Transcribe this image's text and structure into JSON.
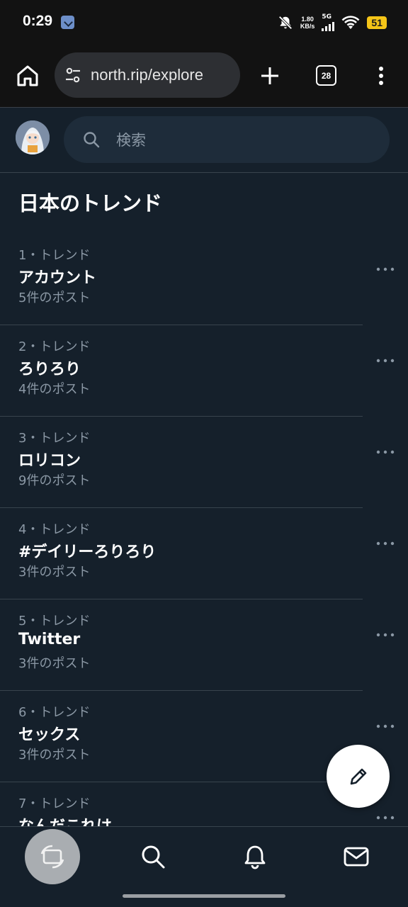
{
  "status_bar": {
    "time": "0:29",
    "net_speed_value": "1.80",
    "net_speed_unit": "KB/s",
    "network_type": "5G",
    "battery": "51",
    "battery_color": "#f5c518"
  },
  "browser": {
    "url": "north.rip/explore",
    "tab_count": "28"
  },
  "search": {
    "placeholder": "検索"
  },
  "section_title": "日本のトレンド",
  "trends": [
    {
      "meta": "1・トレンド",
      "name": "アカウント",
      "count": "5件のポスト"
    },
    {
      "meta": "2・トレンド",
      "name": "ろりろり",
      "count": "4件のポスト"
    },
    {
      "meta": "3・トレンド",
      "name": "ロリコン",
      "count": "9件のポスト"
    },
    {
      "meta": "4・トレンド",
      "name": "#デイリーろりろり",
      "count": "3件のポスト"
    },
    {
      "meta": "5・トレンド",
      "name": "Twitter",
      "count": "3件のポスト"
    },
    {
      "meta": "6・トレンド",
      "name": "セックス",
      "count": "3件のポスト"
    },
    {
      "meta": "7・トレンド",
      "name": "なんだこれは",
      "count": ""
    }
  ],
  "icons": {
    "home": "home-icon",
    "tune": "tune-icon",
    "plus": "plus-icon",
    "tabs": "tabs-icon",
    "menu": "more-vert-icon",
    "search": "search-icon",
    "more": "more-horizontal-icon",
    "compose": "pencil-icon",
    "nav_home": "switch-icon",
    "nav_search": "search-icon",
    "nav_notifications": "bell-icon",
    "nav_messages": "mail-icon"
  },
  "colors": {
    "background": "#15202b",
    "secondary_text": "#8b98a5",
    "divider": "#38444d"
  }
}
